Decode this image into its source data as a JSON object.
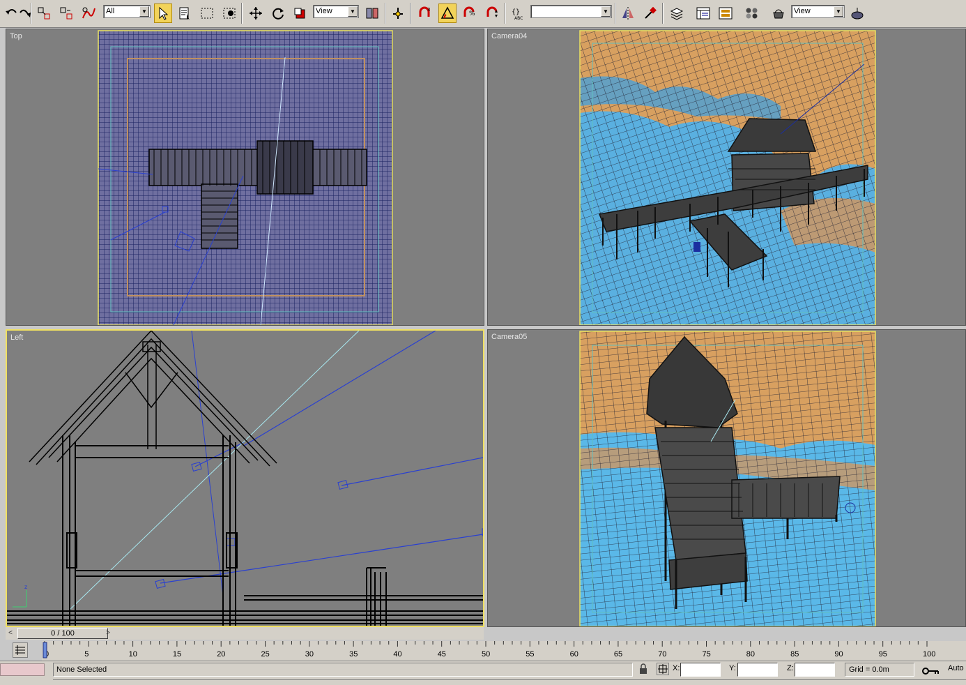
{
  "toolbar": {
    "selection_filter": "All",
    "reference_coord_system": "View",
    "named_selection_set": "",
    "render_type": "View"
  },
  "viewports": {
    "top": {
      "label": "Top",
      "active": false
    },
    "camera04": {
      "label": "Camera04",
      "active": false
    },
    "left": {
      "label": "Left",
      "active": true
    },
    "camera05": {
      "label": "Camera05",
      "active": false
    }
  },
  "time_slider": {
    "label": "0 / 100",
    "current_frame": 0,
    "total_frames": 100
  },
  "track_bar": {
    "ticks": [
      "0",
      "5",
      "10",
      "15",
      "20",
      "25",
      "30",
      "35",
      "40",
      "45",
      "50",
      "55",
      "60",
      "65",
      "70",
      "75",
      "80",
      "85",
      "90",
      "95",
      "100"
    ]
  },
  "status": {
    "selection_text": "None Selected",
    "x_label": "X:",
    "y_label": "Y:",
    "z_label": "Z:",
    "x_value": "",
    "y_value": "",
    "z_value": "",
    "grid_text": "Grid = 0.0m",
    "auto_key_label": "Auto"
  },
  "colors": {
    "viewport_bg": "#7f7f7f",
    "active_border": "#f0e060",
    "safe_frame": "#e8e060",
    "wire_blue": "#1a2ea0",
    "water": "#5ab8e8",
    "sky_orange": "#d8a060",
    "ui_gray": "#d4d0c8"
  }
}
